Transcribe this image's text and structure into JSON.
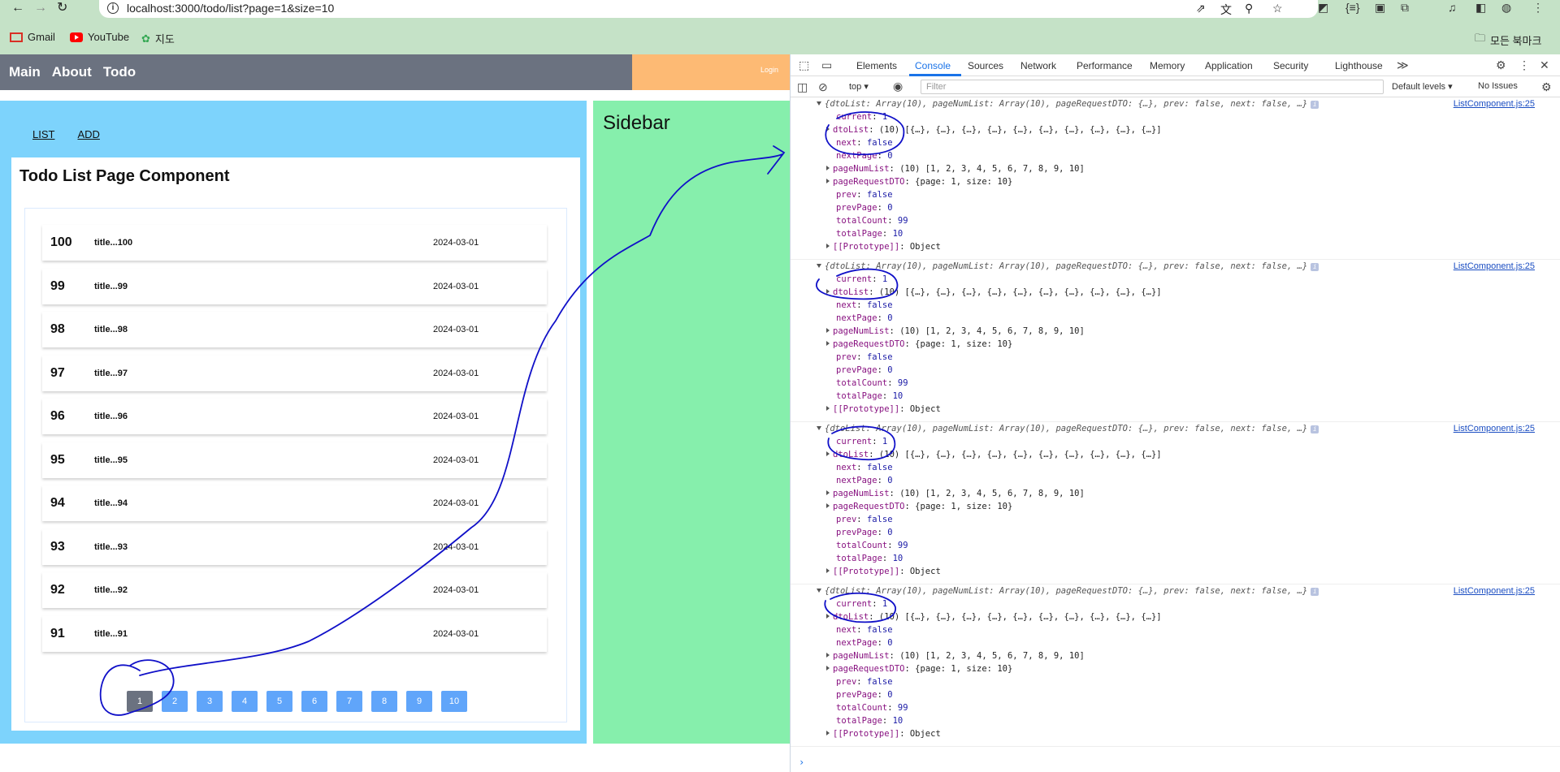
{
  "browser": {
    "url": "localhost:3000/todo/list?page=1&size=10",
    "bookmarks": [
      "Gmail",
      "YouTube",
      "지도"
    ],
    "bookmarks_folder": "모든 북마크"
  },
  "app": {
    "nav": [
      "Main",
      "About",
      "Todo"
    ],
    "login": "Login",
    "subnav": [
      "LIST",
      "ADD"
    ],
    "page_title": "Todo List Page Component",
    "sidebar": "Sidebar",
    "todos": [
      {
        "tno": "100",
        "title": "title...100",
        "date": "2024-03-01"
      },
      {
        "tno": "99",
        "title": "title...99",
        "date": "2024-03-01"
      },
      {
        "tno": "98",
        "title": "title...98",
        "date": "2024-03-01"
      },
      {
        "tno": "97",
        "title": "title...97",
        "date": "2024-03-01"
      },
      {
        "tno": "96",
        "title": "title...96",
        "date": "2024-03-01"
      },
      {
        "tno": "95",
        "title": "title...95",
        "date": "2024-03-01"
      },
      {
        "tno": "94",
        "title": "title...94",
        "date": "2024-03-01"
      },
      {
        "tno": "93",
        "title": "title...93",
        "date": "2024-03-01"
      },
      {
        "tno": "92",
        "title": "title...92",
        "date": "2024-03-01"
      },
      {
        "tno": "91",
        "title": "title...91",
        "date": "2024-03-01"
      }
    ],
    "pages": [
      "1",
      "2",
      "3",
      "4",
      "5",
      "6",
      "7",
      "8",
      "9",
      "10"
    ],
    "current_page": "1"
  },
  "devtools": {
    "tabs": [
      "Elements",
      "Console",
      "Sources",
      "Network",
      "Performance",
      "Memory",
      "Application",
      "Security",
      "Lighthouse"
    ],
    "active_tab": "Console",
    "context": "top",
    "filter_placeholder": "Filter",
    "levels": "Default levels",
    "issues": "No Issues",
    "source_link": "ListComponent.js:25",
    "log_header": "{dtoList: Array(10), pageNumList: Array(10), pageRequestDTO: {…}, prev: false, next: false, …}",
    "log_lines": [
      {
        "key": "current",
        "value": "1",
        "expandable": false
      },
      {
        "key": "dtoList",
        "value": "(10) [{…}, {…}, {…}, {…}, {…}, {…}, {…}, {…}, {…}, {…}]",
        "expandable": true
      },
      {
        "key": "next",
        "value": "false",
        "expandable": false
      },
      {
        "key": "nextPage",
        "value": "0",
        "expandable": false
      },
      {
        "key": "pageNumList",
        "value": "(10) [1, 2, 3, 4, 5, 6, 7, 8, 9, 10]",
        "expandable": true
      },
      {
        "key": "pageRequestDTO",
        "value": "{page: 1, size: 10}",
        "expandable": true
      },
      {
        "key": "prev",
        "value": "false",
        "expandable": false
      },
      {
        "key": "prevPage",
        "value": "0",
        "expandable": false
      },
      {
        "key": "totalCount",
        "value": "99",
        "expandable": false
      },
      {
        "key": "totalPage",
        "value": "10",
        "expandable": false
      },
      {
        "key": "[[Prototype]]",
        "value": "Object",
        "expandable": true
      }
    ],
    "entry_count": 4
  },
  "colors": {
    "annotation_ink": "#1010c8",
    "nav_bg": "#6b7280",
    "login_bg": "#fdba74",
    "main_bg": "#7dd3fc",
    "sidebar_bg": "#86efac",
    "page_button": "#60a5fa"
  }
}
